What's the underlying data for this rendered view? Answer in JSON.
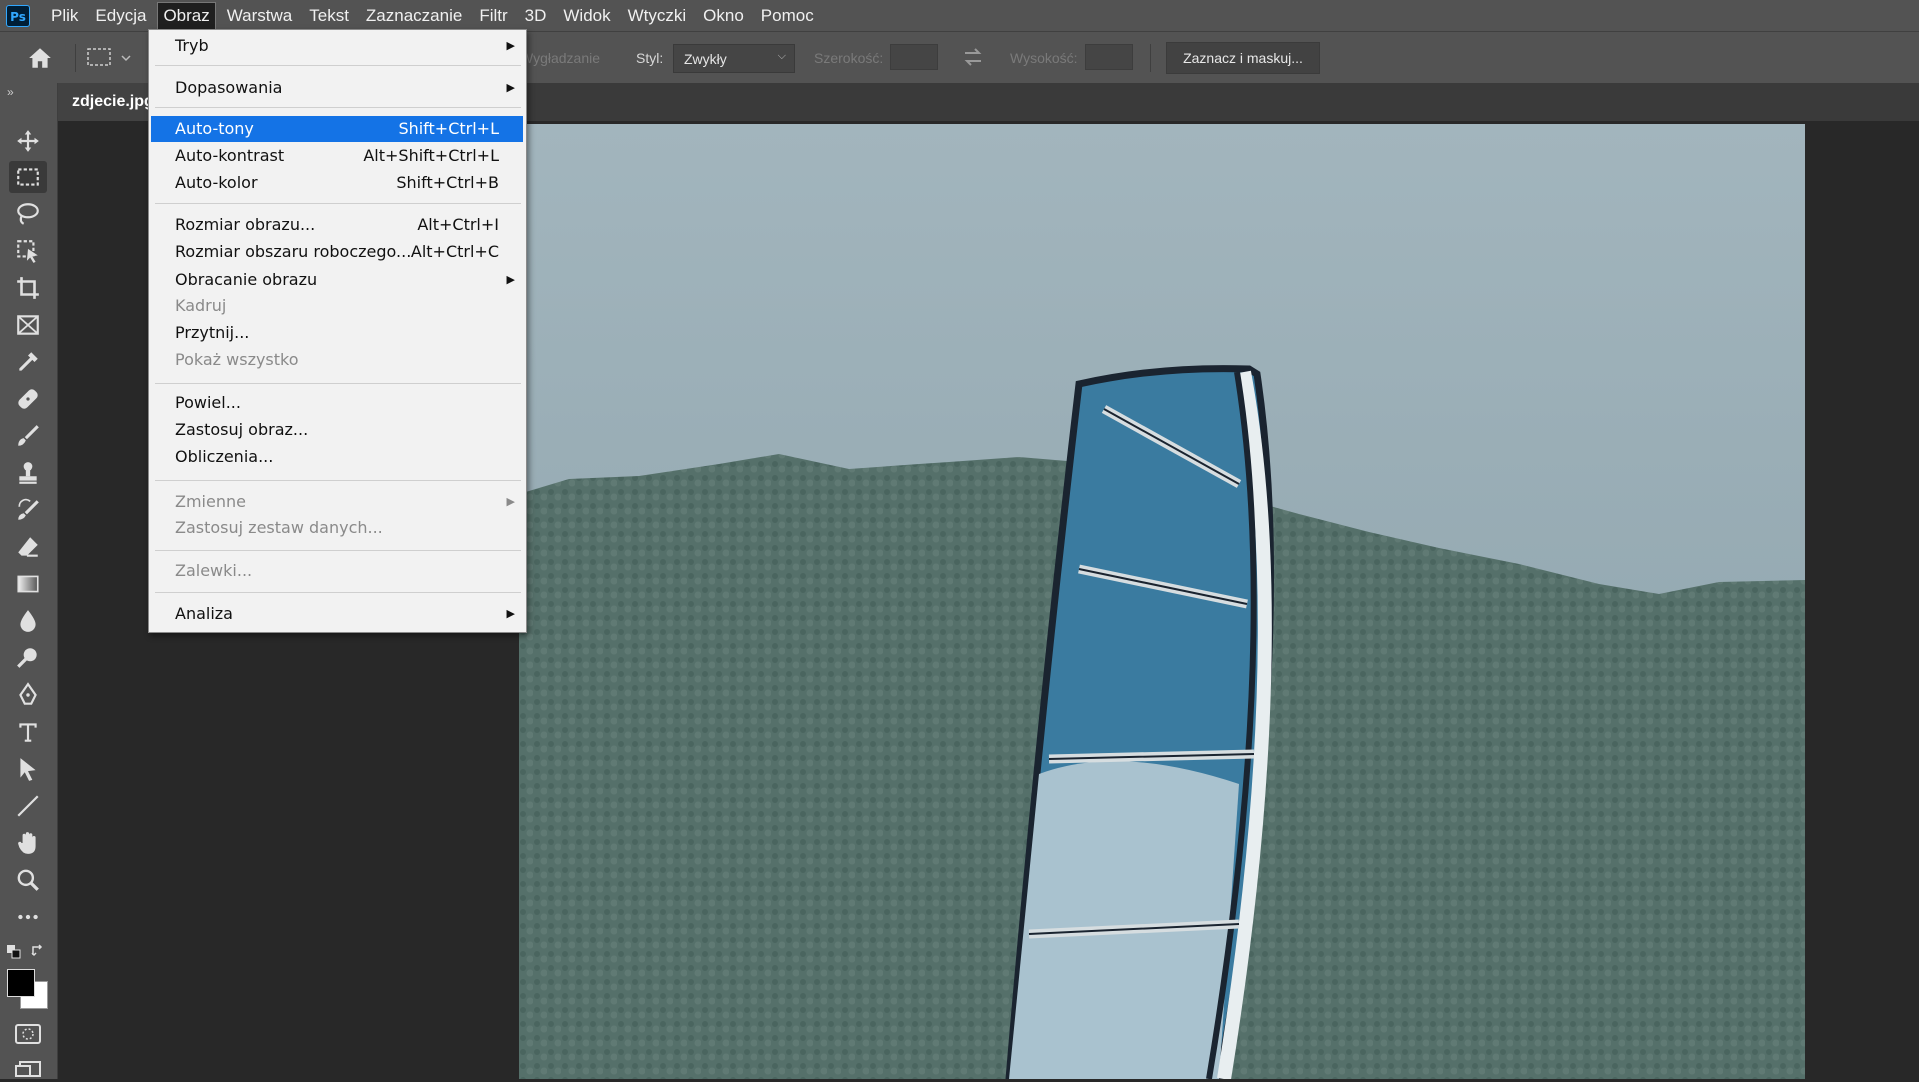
{
  "app": {
    "logo_text": "Ps",
    "accent": "#31a8ff"
  },
  "menubar": {
    "items": [
      "Plik",
      "Edycja",
      "Obraz",
      "Warstwa",
      "Tekst",
      "Zaznaczanie",
      "Filtr",
      "3D",
      "Widok",
      "Wtyczki",
      "Okno",
      "Pomoc"
    ],
    "active": "Obraz"
  },
  "options": {
    "antialias_label": "Wygładzanie",
    "style_label": "Styl:",
    "style_value": "Zwykły",
    "width_label": "Szerokość:",
    "height_label": "Wysokość:",
    "select_mask_label": "Zaznacz i maskuj..."
  },
  "document": {
    "tab_label": "zdjecie.jpg"
  },
  "image_menu": {
    "items": [
      {
        "label": "Tryb",
        "submenu": true
      },
      {
        "label": "Dopasowania",
        "submenu": true
      },
      {
        "label": "Auto-tony",
        "shortcut": "Shift+Ctrl+L",
        "selected": true
      },
      {
        "label": "Auto-kontrast",
        "shortcut": "Alt+Shift+Ctrl+L"
      },
      {
        "label": "Auto-kolor",
        "shortcut": "Shift+Ctrl+B"
      },
      {
        "label": "Rozmiar obrazu...",
        "shortcut": "Alt+Ctrl+I"
      },
      {
        "label": "Rozmiar obszaru roboczego...",
        "shortcut": "Alt+Ctrl+C"
      },
      {
        "label": "Obracanie obrazu",
        "submenu": true
      },
      {
        "label": "Kadruj",
        "disabled": true
      },
      {
        "label": "Przytnij..."
      },
      {
        "label": "Pokaż wszystko",
        "disabled": true
      },
      {
        "label": "Powiel..."
      },
      {
        "label": "Zastosuj obraz..."
      },
      {
        "label": "Obliczenia..."
      },
      {
        "label": "Zmienne",
        "submenu": true,
        "disabled": true
      },
      {
        "label": "Zastosuj zestaw danych...",
        "disabled": true
      },
      {
        "label": "Zalewki...",
        "disabled": true
      },
      {
        "label": "Analiza",
        "submenu": true
      }
    ]
  },
  "tools": [
    "home-icon",
    "rect-marquee-icon",
    "move-icon",
    "lasso-icon",
    "object-select-icon",
    "crop-icon",
    "frame-icon",
    "eyedropper-icon",
    "healing-brush-icon",
    "brush-icon",
    "stamp-icon",
    "history-brush-icon",
    "eraser-icon",
    "gradient-icon",
    "blur-icon",
    "dodge-icon",
    "pen-icon",
    "type-icon",
    "path-select-icon",
    "line-icon",
    "hand-icon",
    "zoom-icon",
    "more-tools-icon"
  ],
  "colors": {
    "foreground": "#000000",
    "background": "#ffffff",
    "menu_highlight": "#1473e6"
  }
}
